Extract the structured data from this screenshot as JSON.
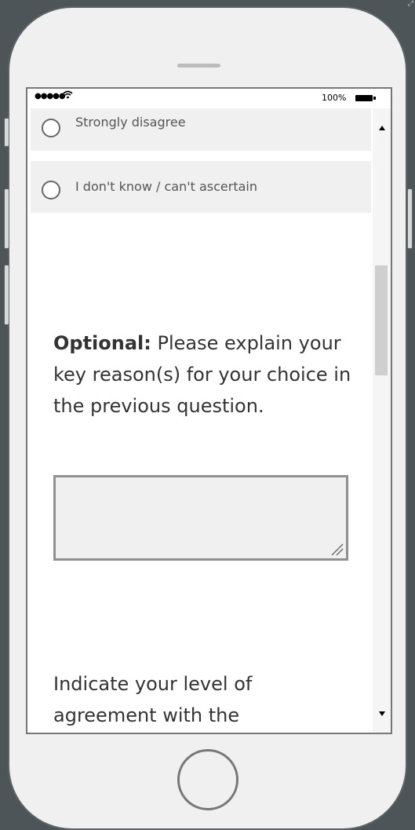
{
  "status_bar": {
    "signal": "●●●●●",
    "wifi_icon": "wifi-icon",
    "battery_text": "100%"
  },
  "options": [
    {
      "label": "Strongly disagree"
    },
    {
      "label": "I don't know / can't ascertain"
    }
  ],
  "question1": {
    "bold": "Optional:",
    "text": " Please explain your key reason(s) for your choice in the previous question."
  },
  "textarea": {
    "value": ""
  },
  "question2": {
    "text": "Indicate your level of agreement with the"
  },
  "colors": {
    "device_border": "#5d6468",
    "backdrop": "#4d5558",
    "option_bg": "#f0f0f0"
  }
}
